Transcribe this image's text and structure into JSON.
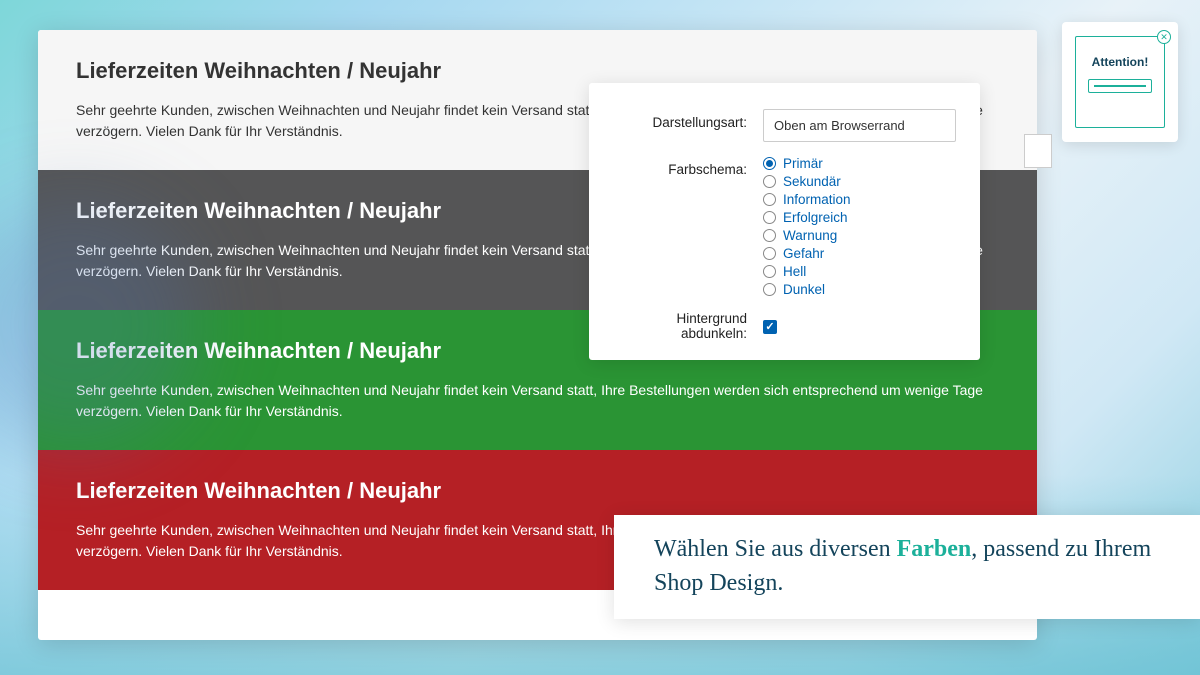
{
  "banners": [
    {
      "title": "Lieferzeiten Weihnachten / Neujahr",
      "body": "Sehr geehrte Kunden, zwischen Weihnachten und Neujahr findet kein Versand statt, Ihre Bestellungen werden sich entsprechend um wenige Tage verzögern. Vielen Dank für Ihr Verständnis."
    },
    {
      "title": "Lieferzeiten Weihnachten / Neujahr",
      "body": "Sehr geehrte Kunden, zwischen Weihnachten und Neujahr findet kein Versand statt, Ihre Bestellungen werden sich entsprechend um wenige Tage verzögern. Vielen Dank für Ihr Verständnis."
    },
    {
      "title": "Lieferzeiten Weihnachten / Neujahr",
      "body": "Sehr geehrte Kunden, zwischen Weihnachten und Neujahr findet kein Versand statt, Ihre Bestellungen werden sich entsprechend um wenige Tage verzögern. Vielen Dank für Ihr Verständnis."
    },
    {
      "title": "Lieferzeiten Weihnachten / Neujahr",
      "body": "Sehr geehrte Kunden, zwischen Weihnachten und Neujahr findet kein Versand statt, Ihre Bestellungen werden sich entsprechend um wenige Tage verzögern. Vielen Dank für Ihr Verständnis."
    }
  ],
  "settings": {
    "display_label": "Darstellungsart:",
    "display_value": "Oben am Browserrand",
    "color_label": "Farbschema:",
    "colors": [
      {
        "label": "Primär",
        "selected": true
      },
      {
        "label": "Sekundär",
        "selected": false
      },
      {
        "label": "Information",
        "selected": false
      },
      {
        "label": "Erfolgreich",
        "selected": false
      },
      {
        "label": "Warnung",
        "selected": false
      },
      {
        "label": "Gefahr",
        "selected": false
      },
      {
        "label": "Hell",
        "selected": false
      },
      {
        "label": "Dunkel",
        "selected": false
      }
    ],
    "darken_label": "Hintergrund abdunkeln:",
    "darken_checked": true
  },
  "attention": {
    "title": "Attention!"
  },
  "tagline": {
    "part1": "Wählen Sie aus diversen ",
    "accent": "Farben",
    "part2": ", passend zu Ihrem Shop Design."
  }
}
